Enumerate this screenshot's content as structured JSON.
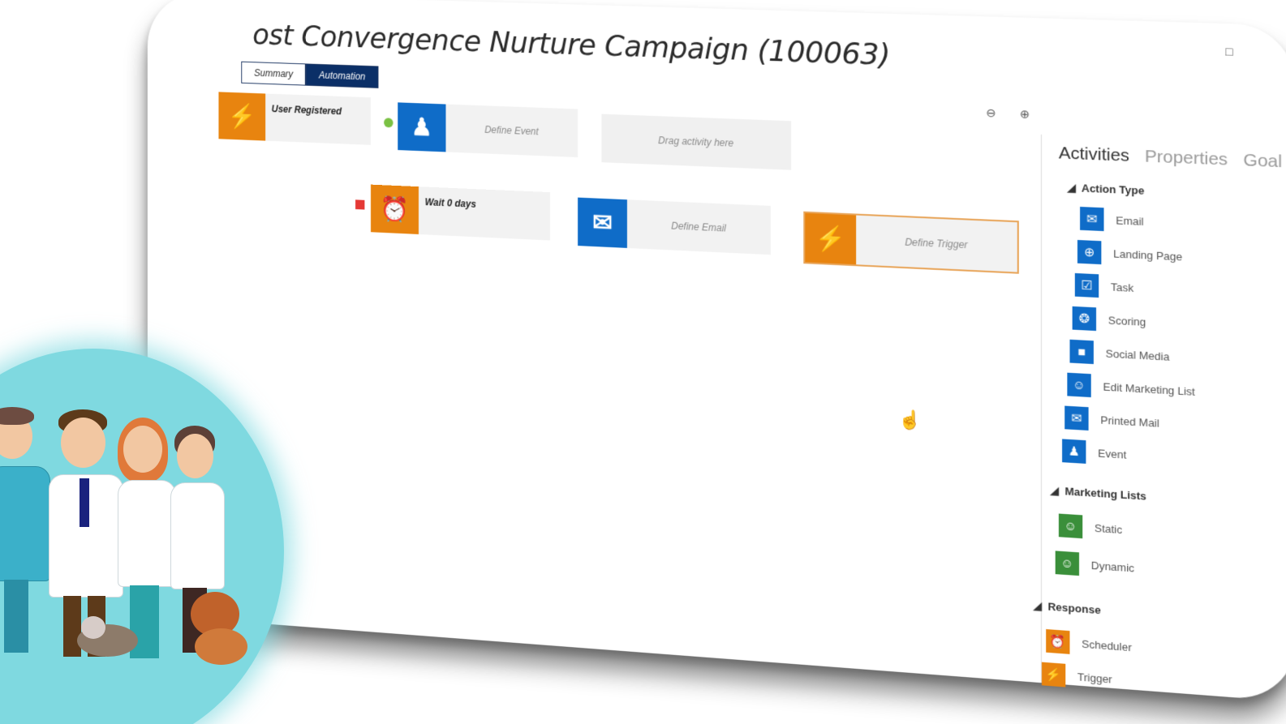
{
  "title": "ost Convergence Nurture Campaign (100063)",
  "tabs": [
    {
      "label": "Summary",
      "active": false
    },
    {
      "label": "Automation",
      "active": true
    }
  ],
  "canvas": {
    "tiles": [
      {
        "label": "User Registered",
        "icon": "lightning-icon",
        "color": "#e8840f"
      },
      {
        "label": "Define Event",
        "icon": "event-icon",
        "color": "#0f6cc8"
      },
      {
        "label": "Drag activity here",
        "icon": "",
        "color": ""
      },
      {
        "label": "Wait 0 days",
        "icon": "alarm-clock-icon",
        "color": "#e8840f"
      },
      {
        "label": "Define Email",
        "icon": "envelope-icon",
        "color": "#0f6cc8"
      },
      {
        "label": "Define Trigger",
        "icon": "lightning-icon",
        "color": "#e8840f"
      }
    ],
    "colors": {
      "positive": "#4caf50",
      "negative": "#e53935"
    }
  },
  "panel": {
    "tabs": [
      {
        "label": "Activities",
        "active": true
      },
      {
        "label": "Properties",
        "active": false
      },
      {
        "label": "Goal",
        "active": false
      }
    ],
    "sections": [
      {
        "title": "Action Type",
        "items": [
          {
            "label": "Email",
            "icon": "envelope-icon"
          },
          {
            "label": "Landing Page",
            "icon": "globe-icon"
          },
          {
            "label": "Task",
            "icon": "checklist-icon"
          },
          {
            "label": "Scoring",
            "icon": "ribbon-icon"
          },
          {
            "label": "Social Media",
            "icon": "speech-bubble-icon"
          },
          {
            "label": "Edit Marketing List",
            "icon": "people-icon"
          },
          {
            "label": "Printed Mail",
            "icon": "printed-mail-icon"
          },
          {
            "label": "Event",
            "icon": "event-icon"
          }
        ]
      },
      {
        "title": "Marketing Lists",
        "items": [
          {
            "label": "Static",
            "icon": "people-icon"
          },
          {
            "label": "Dynamic",
            "icon": "people-icon"
          }
        ]
      },
      {
        "title": "Response",
        "items": [
          {
            "label": "Scheduler",
            "icon": "alarm-clock-icon"
          },
          {
            "label": "Trigger",
            "icon": "lightning-icon"
          }
        ]
      }
    ]
  }
}
